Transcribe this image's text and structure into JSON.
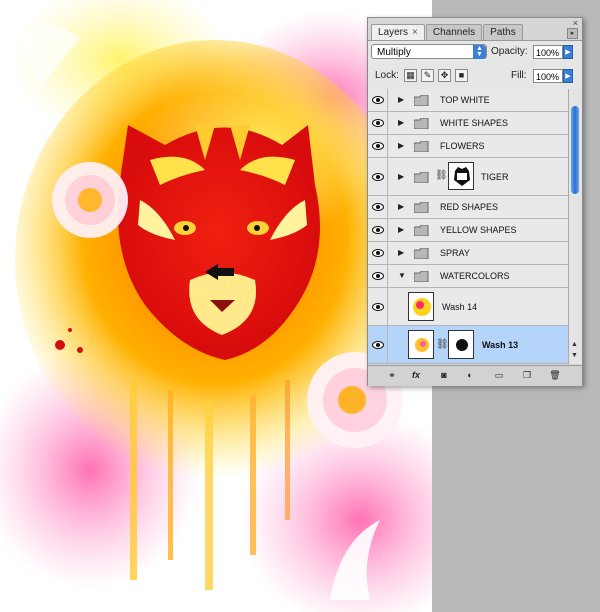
{
  "panel": {
    "tabs": [
      {
        "label": "Layers",
        "active": true
      },
      {
        "label": "Channels",
        "active": false
      },
      {
        "label": "Paths",
        "active": false
      }
    ],
    "close_glyph": "×",
    "blend_mode": "Multiply",
    "opacity_label": "Opacity:",
    "opacity_value": "100%",
    "lock_label": "Lock:",
    "fill_label": "Fill:",
    "fill_value": "100%",
    "layers": [
      {
        "name": "TOP WHITE",
        "type": "group",
        "expanded": false
      },
      {
        "name": "WHITE SHAPES",
        "type": "group",
        "expanded": false
      },
      {
        "name": "FLOWERS",
        "type": "group",
        "expanded": false
      },
      {
        "name": "TIGER",
        "type": "group",
        "expanded": false,
        "has_mask": true
      },
      {
        "name": "RED SHAPES",
        "type": "group",
        "expanded": false
      },
      {
        "name": "YELLOW SHAPES",
        "type": "group",
        "expanded": false
      },
      {
        "name": "SPRAY",
        "type": "group",
        "expanded": false
      },
      {
        "name": "WATERCOLORS",
        "type": "group",
        "expanded": true
      },
      {
        "name": "Wash 14",
        "type": "layer"
      },
      {
        "name": "Wash 13",
        "type": "layer",
        "selected": true,
        "has_mask": true
      }
    ]
  },
  "icons": {
    "visibility": "eye-icon",
    "group": "folder-icon",
    "link": "chain-link-icon",
    "arrow": "left-arrow-icon"
  },
  "colors": {
    "selection": "#b5d4fa",
    "scrollbar": "#2c6fd0",
    "canvas_side": "#b9b9b9"
  }
}
